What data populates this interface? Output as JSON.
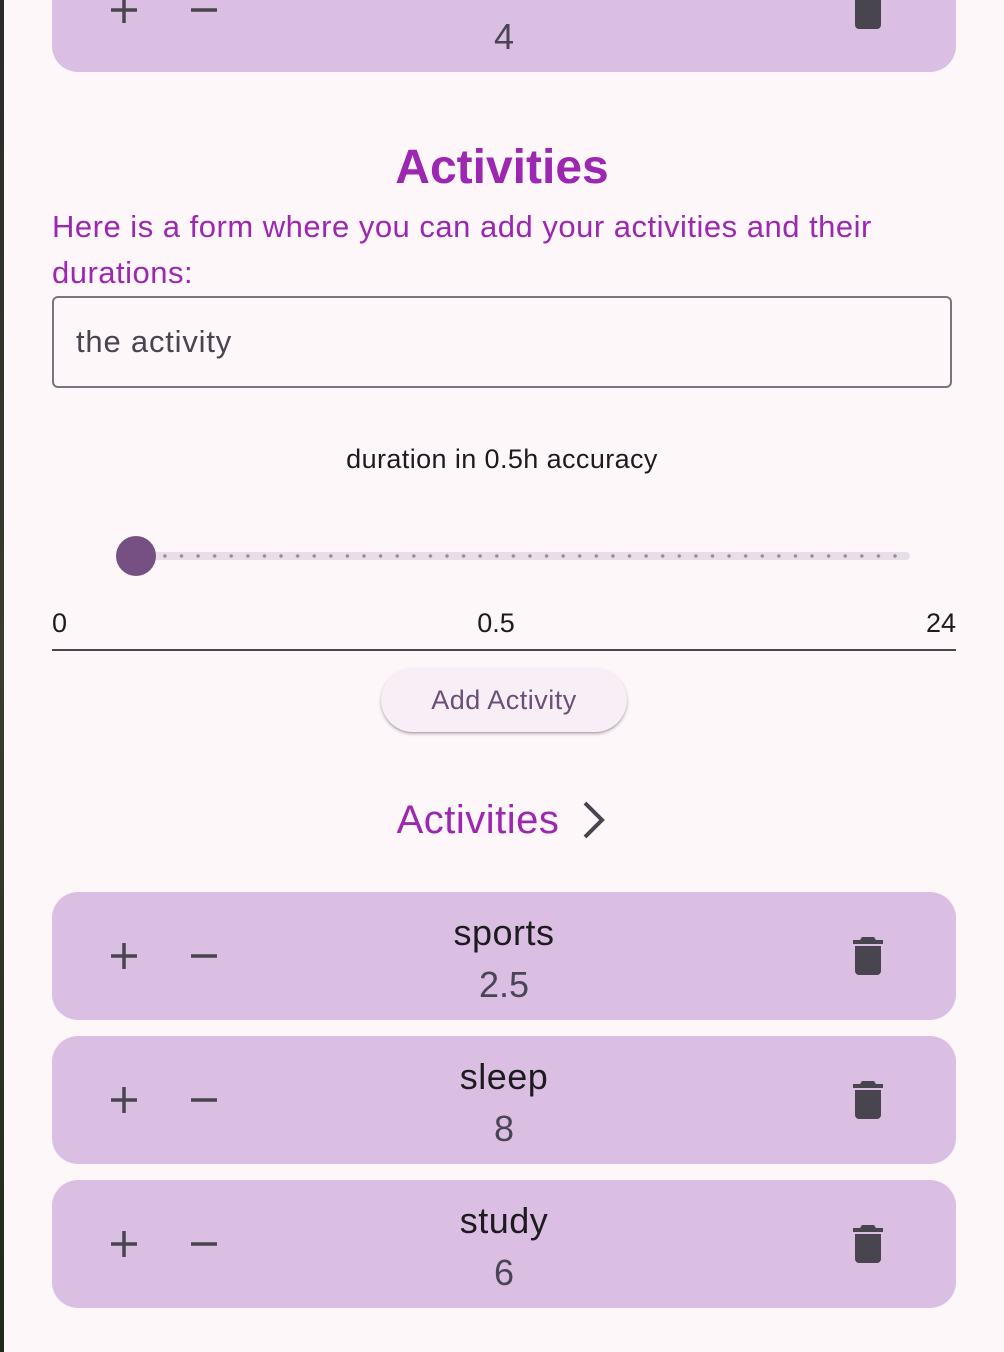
{
  "top_card": {
    "value": "4"
  },
  "activities_form": {
    "title": "Activities",
    "intro_text": "Here is a form where you can add your activities and their durations:",
    "activity_input": {
      "placeholder": "the activity",
      "value": ""
    },
    "slider_label": "duration in 0.5h accuracy",
    "slider": {
      "min": "0",
      "current": "0.5",
      "max": "24",
      "current_value": 0.5,
      "min_value": 0,
      "max_value": 24,
      "step": 0.5
    },
    "add_button_label": "Add Activity"
  },
  "activities_list": {
    "header_label": "Activities",
    "header_icon": "chevron-right-icon",
    "items": [
      {
        "name": "sports",
        "duration": "2.5"
      },
      {
        "name": "sleep",
        "duration": "8"
      },
      {
        "name": "study",
        "duration": "6"
      }
    ]
  },
  "icons": {
    "increment": "plus-icon",
    "decrement": "minus-icon",
    "delete": "trash-icon"
  },
  "colors": {
    "background": "#fdf7fa",
    "card": "#dbbfe3",
    "accent": "#9c27b0",
    "slider_thumb": "#765083",
    "icon": "#49454f"
  }
}
